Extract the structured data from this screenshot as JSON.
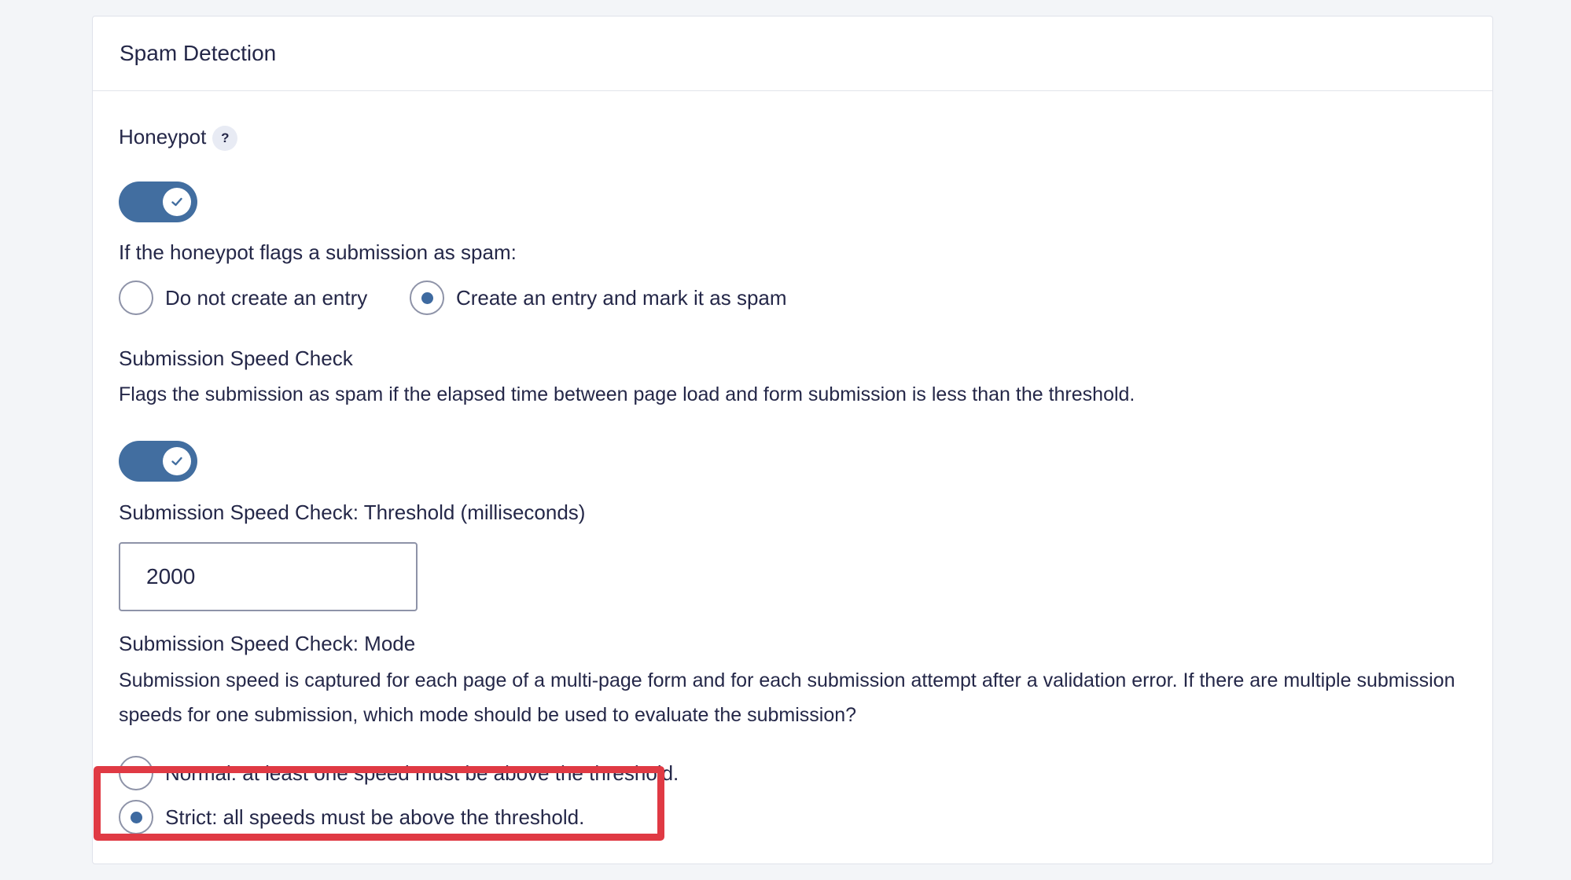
{
  "panel": {
    "title": "Spam Detection"
  },
  "honeypot": {
    "label": "Honeypot",
    "help_glyph": "?",
    "help_icon": "question-circle-icon",
    "toggle_on": true,
    "check_icon": "checkmark-icon"
  },
  "honeypot_action": {
    "label": "If the honeypot flags a submission as spam:",
    "options": [
      {
        "label": "Do not create an entry",
        "selected": false
      },
      {
        "label": "Create an entry and mark it as spam",
        "selected": true
      }
    ]
  },
  "speed_check": {
    "label": "Submission Speed Check",
    "description": "Flags the submission as spam if the elapsed time between page load and form submission is less than the threshold.",
    "toggle_on": true
  },
  "threshold": {
    "label": "Submission Speed Check: Threshold (milliseconds)",
    "value": "2000"
  },
  "mode": {
    "label": "Submission Speed Check: Mode",
    "description": "Submission speed is captured for each page of a multi-page form and for each submission attempt after a validation error. If there are multiple submission speeds for one submission, which mode should be used to evaluate the submission?",
    "options": [
      {
        "label": "Normal: at least one speed must be above the threshold.",
        "selected": false
      },
      {
        "label": "Strict: all speeds must be above the threshold.",
        "selected": true
      }
    ]
  },
  "colors": {
    "accent": "#426ea0",
    "highlight": "#e03a44",
    "text": "#242748",
    "background": "#f3f5f8"
  }
}
